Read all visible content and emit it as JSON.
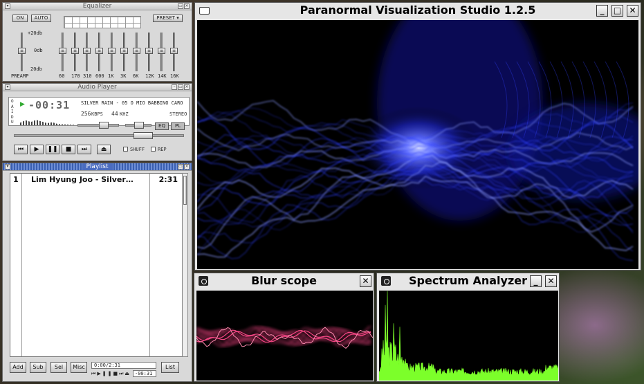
{
  "equalizer": {
    "title": "Equalizer",
    "on_label": "ON",
    "auto_label": "AUTO",
    "preset_label": "PRESET",
    "db_max": "+20db",
    "db_zero": "0db",
    "db_min": "20db",
    "preamp_label": "PREAMP",
    "bands": [
      "60",
      "170",
      "310",
      "600",
      "1K",
      "3K",
      "6K",
      "12K",
      "14K",
      "16K"
    ]
  },
  "player": {
    "title": "Audio Player",
    "time": "-00:31",
    "song": "SILVER RAIN - 05 O MIO BABBINO CARO",
    "bitrate": "256",
    "kbps_label": "KBPS",
    "khz": "44",
    "khz_label": "KHZ",
    "stereo_label": "STEREO",
    "eq_label": "EQ",
    "pl_label": "PL",
    "shuffle_label": "SHUFF",
    "repeat_label": "REP",
    "status_letters": [
      "O",
      "A",
      "I",
      "D",
      "U"
    ]
  },
  "playlist": {
    "title": "Playlist",
    "items": [
      {
        "num": "1",
        "title": "Lim Hyung Joo - Silver…",
        "duration": "2:31"
      }
    ],
    "buttons": {
      "add": "Add",
      "sub": "Sub",
      "sel": "Sel",
      "misc": "Misc",
      "list": "List"
    },
    "time_display": "0:00/2:31",
    "remaining": "-00:31"
  },
  "pvs": {
    "title": "Paranormal Visualization Studio 1.2.5"
  },
  "blur": {
    "title": "Blur scope"
  },
  "spectrum": {
    "title": "Spectrum Analyzer"
  },
  "window_buttons": {
    "minimize": "_",
    "maximize": "□",
    "close": "✕"
  },
  "colors": {
    "viz_blue": "#3040ff",
    "scope_pink": "#ff4a8a",
    "spectrum_green": "#7cff2a"
  }
}
